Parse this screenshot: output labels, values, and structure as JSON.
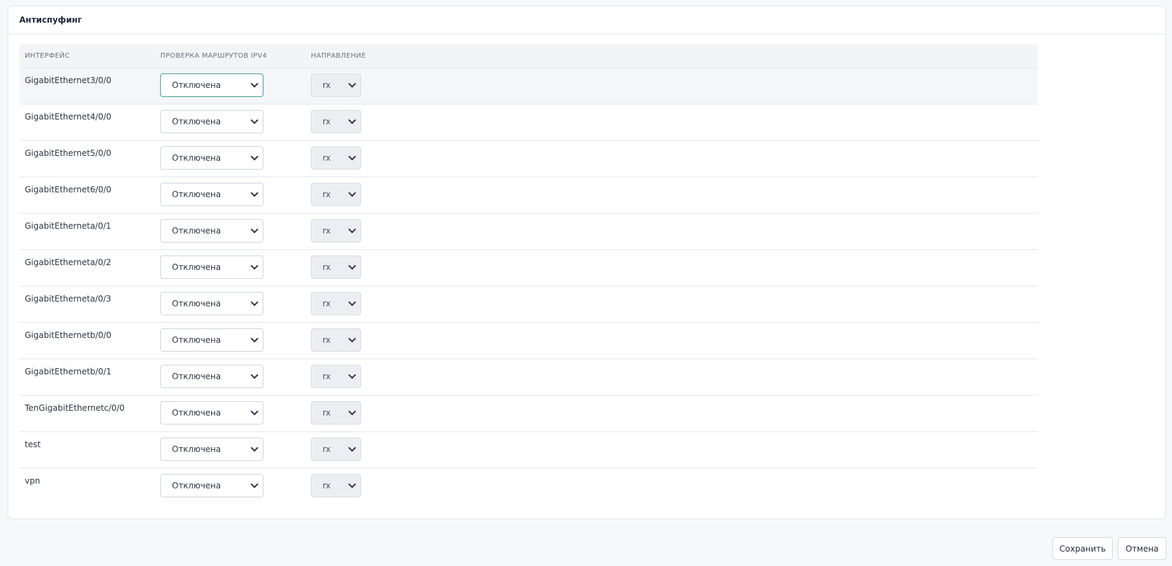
{
  "panel": {
    "title": "Антиспуфинг"
  },
  "table": {
    "headers": {
      "interface": "ИНТЕРФЕЙС",
      "check": "ПРОВЕРКА МАРШРУТОВ IPV4",
      "direction": "НАПРАВЛЕНИЕ"
    },
    "rows": [
      {
        "interface": "GigabitEthernet3/0/0",
        "check": "Отключена",
        "direction": "rx"
      },
      {
        "interface": "GigabitEthernet4/0/0",
        "check": "Отключена",
        "direction": "rx"
      },
      {
        "interface": "GigabitEthernet5/0/0",
        "check": "Отключена",
        "direction": "rx"
      },
      {
        "interface": "GigabitEthernet6/0/0",
        "check": "Отключена",
        "direction": "rx"
      },
      {
        "interface": "GigabitEtherneta/0/1",
        "check": "Отключена",
        "direction": "rx"
      },
      {
        "interface": "GigabitEtherneta/0/2",
        "check": "Отключена",
        "direction": "rx"
      },
      {
        "interface": "GigabitEtherneta/0/3",
        "check": "Отключена",
        "direction": "rx"
      },
      {
        "interface": "GigabitEthernetb/0/0",
        "check": "Отключена",
        "direction": "rx"
      },
      {
        "interface": "GigabitEthernetb/0/1",
        "check": "Отключена",
        "direction": "rx"
      },
      {
        "interface": "TenGigabitEthernetc/0/0",
        "check": "Отключена",
        "direction": "rx"
      },
      {
        "interface": "test",
        "check": "Отключена",
        "direction": "rx"
      },
      {
        "interface": "vpn",
        "check": "Отключена",
        "direction": "rx"
      }
    ]
  },
  "actions": {
    "save_label": "Сохранить",
    "cancel_label": "Отмена"
  },
  "colors": {
    "focus_border": "#5fa8a3",
    "selected_row": "#f5f6f7"
  }
}
